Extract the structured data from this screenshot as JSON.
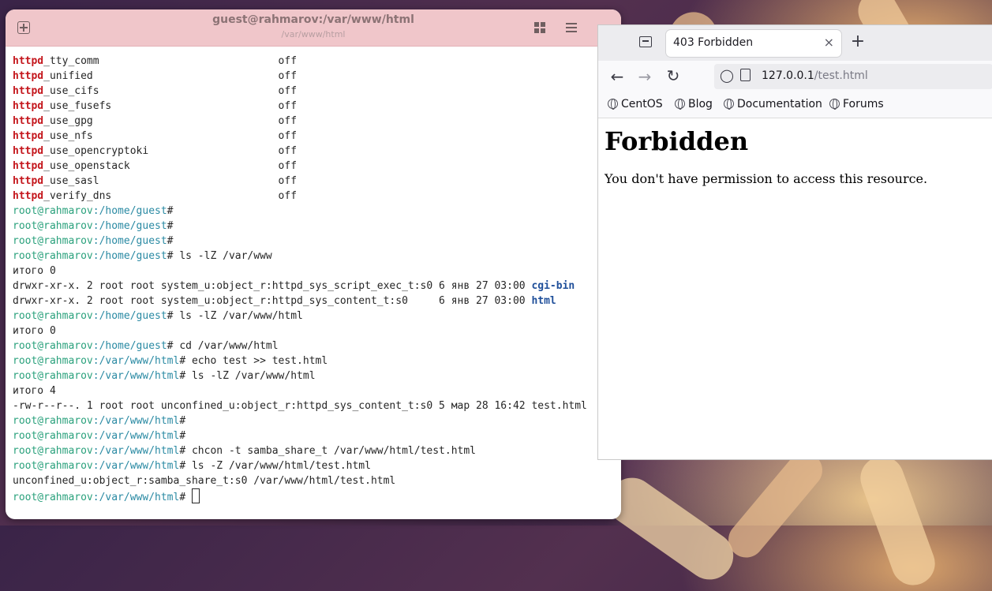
{
  "terminal": {
    "title": "guest@rahmarov:/var/www/html",
    "subtitle": "/var/www/html",
    "new_tab_icon": "plus-square-icon",
    "grid_icon": "grid-icon",
    "menu_icon": "hamburger-menu-icon",
    "lines": [
      {
        "hl": "httpd",
        "text": "_tty_comm                             off"
      },
      {
        "hl": "httpd",
        "text": "_unified                              off"
      },
      {
        "hl": "httpd",
        "text": "_use_cifs                             off"
      },
      {
        "hl": "httpd",
        "text": "_use_fusefs                           off"
      },
      {
        "hl": "httpd",
        "text": "_use_gpg                              off"
      },
      {
        "hl": "httpd",
        "text": "_use_nfs                              off"
      },
      {
        "hl": "httpd",
        "text": "_use_opencryptoki                     off"
      },
      {
        "hl": "httpd",
        "text": "_use_openstack                        off"
      },
      {
        "hl": "httpd",
        "text": "_use_sasl                             off"
      },
      {
        "hl": "httpd",
        "text": "_verify_dns                           off"
      },
      {
        "user": "root@rahmarov",
        "path": ":/home/guest",
        "cmd": "#"
      },
      {
        "user": "root@rahmarov",
        "path": ":/home/guest",
        "cmd": "#"
      },
      {
        "user": "root@rahmarov",
        "path": ":/home/guest",
        "cmd": "#"
      },
      {
        "user": "root@rahmarov",
        "path": ":/home/guest",
        "cmd": "# ls -lZ /var/www"
      },
      {
        "text": "итого 0"
      },
      {
        "text": "drwxr-xr-x. 2 root root system_u:object_r:httpd_sys_script_exec_t:s0 6 янв 27 03:00 ",
        "dir": "cgi-bin"
      },
      {
        "text": "drwxr-xr-x. 2 root root system_u:object_r:httpd_sys_content_t:s0     6 янв 27 03:00 ",
        "dir": "html"
      },
      {
        "user": "root@rahmarov",
        "path": ":/home/guest",
        "cmd": "# ls -lZ /var/www/html"
      },
      {
        "text": "итого 0"
      },
      {
        "user": "root@rahmarov",
        "path": ":/home/guest",
        "cmd": "# cd /var/www/html"
      },
      {
        "user": "root@rahmarov",
        "path": ":/var/www/html",
        "cmd": "# echo test >> test.html"
      },
      {
        "user": "root@rahmarov",
        "path": ":/var/www/html",
        "cmd": "# ls -lZ /var/www/html"
      },
      {
        "text": "итого 4"
      },
      {
        "text": "-rw-r--r--. 1 root root unconfined_u:object_r:httpd_sys_content_t:s0 5 мар 28 16:42 test.html"
      },
      {
        "user": "root@rahmarov",
        "path": ":/var/www/html",
        "cmd": "#"
      },
      {
        "user": "root@rahmarov",
        "path": ":/var/www/html",
        "cmd": "#"
      },
      {
        "user": "root@rahmarov",
        "path": ":/var/www/html",
        "cmd": "# chcon -t samba_share_t /var/www/html/test.html"
      },
      {
        "user": "root@rahmarov",
        "path": ":/var/www/html",
        "cmd": "# ls -Z /var/www/html/test.html"
      },
      {
        "text": "unconfined_u:object_r:samba_share_t:s0 /var/www/html/test.html"
      },
      {
        "user": "root@rahmarov",
        "path": ":/var/www/html",
        "cmd": "# ",
        "cursor": true
      }
    ]
  },
  "browser": {
    "tab_title": "403 Forbidden",
    "tab_close": "×",
    "new_tab": "+",
    "url_host": "127.0.0.1",
    "url_rest": "/test.html",
    "bookmarks": [
      "CentOS",
      "Blog",
      "Documentation",
      "Forums"
    ],
    "page_heading": "Forbidden",
    "page_text": "You don't have permission to access this resource."
  }
}
